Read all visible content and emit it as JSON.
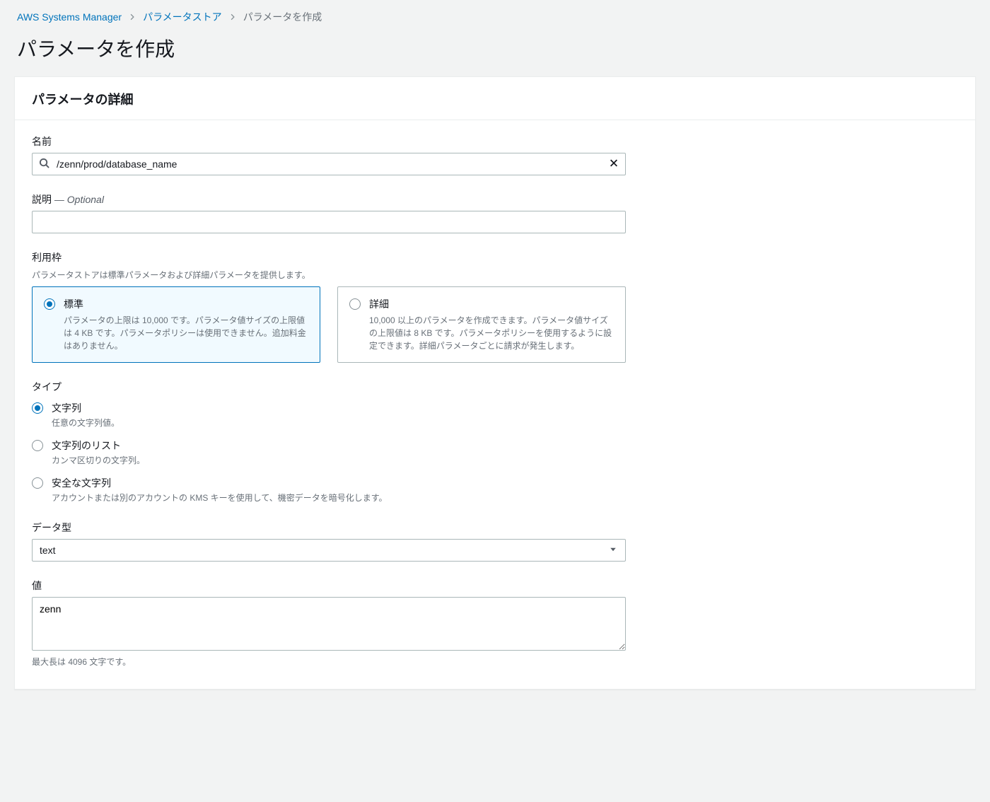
{
  "breadcrumb": {
    "root": "AWS Systems Manager",
    "parent": "パラメータストア",
    "current": "パラメータを作成"
  },
  "page_title": "パラメータを作成",
  "panel_title": "パラメータの詳細",
  "name": {
    "label": "名前",
    "value": "/zenn/prod/database_name"
  },
  "description": {
    "label": "説明",
    "optional": "— Optional",
    "value": ""
  },
  "tier": {
    "label": "利用枠",
    "hint": "パラメータストアは標準パラメータおよび詳細パラメータを提供します。",
    "options": [
      {
        "label": "標準",
        "desc": "パラメータの上限は 10,000 です。パラメータ値サイズの上限値は 4 KB です。パラメータポリシーは使用できません。追加料金はありません。",
        "selected": true
      },
      {
        "label": "詳細",
        "desc": "10,000 以上のパラメータを作成できます。パラメータ値サイズの上限値は 8 KB です。パラメータポリシーを使用するように設定できます。詳細パラメータごとに請求が発生します。",
        "selected": false
      }
    ]
  },
  "type": {
    "label": "タイプ",
    "options": [
      {
        "label": "文字列",
        "desc": "任意の文字列値。",
        "selected": true
      },
      {
        "label": "文字列のリスト",
        "desc": "カンマ区切りの文字列。",
        "selected": false
      },
      {
        "label": "安全な文字列",
        "desc": "アカウントまたは別のアカウントの KMS キーを使用して、機密データを暗号化します。",
        "selected": false
      }
    ]
  },
  "data_type": {
    "label": "データ型",
    "value": "text"
  },
  "value": {
    "label": "値",
    "value": "zenn",
    "hint": "最大長は 4096 文字です。"
  }
}
